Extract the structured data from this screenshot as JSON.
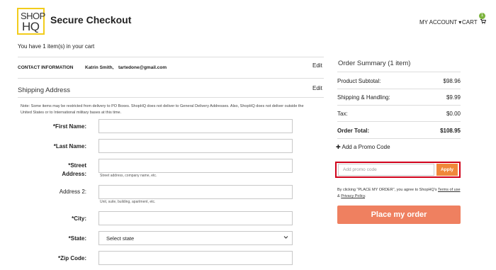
{
  "header": {
    "logo_line1": "SHOP",
    "logo_line2": "HQ",
    "title": "Secure Checkout",
    "account_label": "MY ACCOUNT ▾",
    "cart_label": "CART",
    "cart_icon": "cart-icon",
    "cart_badge": "1"
  },
  "cart_status": "You have 1 item(s) in your cart",
  "contact": {
    "label": "CONTACT INFORMATION",
    "name": "Katrin Smith,",
    "email": "tartedone@gmail.com",
    "edit_label": "Edit"
  },
  "shipping": {
    "title": "Shipping Address",
    "edit_label": "Edit",
    "note": "Note: Some items may be restricted from delivery to PO Boxes. ShopHQ does not deliver to General Delivery Addresses. Also, ShopHQ does not deliver outside the United States or to International military bases at this time.",
    "fields": {
      "first_name": "*First Name:",
      "last_name": "*Last Name:",
      "street_line1": "*Street",
      "street_line2": "Address:",
      "street_hint": "Street address, company name, etc.",
      "address2": "Address 2:",
      "address2_hint": "Unit, suite, building, apartment, etc.",
      "city": "*City:",
      "state": "*State:",
      "state_value": "Select state",
      "zip": "*Zip Code:"
    }
  },
  "summary": {
    "title": "Order Summary (1 item)",
    "rows": [
      {
        "label": "Product Subtotal:",
        "value": "$98.96"
      },
      {
        "label": "Shipping & Handling:",
        "value": "$9.99"
      },
      {
        "label": "Tax:",
        "value": "$0.00"
      }
    ],
    "total_label": "Order Total:",
    "total_value": "$108.95",
    "promo_link": "✚ Add a Promo Code",
    "promo_placeholder": "Add promo code",
    "promo_apply": "Apply",
    "legal_prefix": "By clicking \"PLACE MY ORDER\", you agree to ShopHQ's",
    "terms_link": "Terms of use",
    "legal_and": "&",
    "privacy_link": "Privacy Policy",
    "legal_suffix": ".",
    "place_order": "Place my order"
  },
  "colors": {
    "logo_border": "#f2cc1c",
    "badge": "#7bb33c",
    "apply": "#f0883a",
    "place_order": "#ef8060",
    "promo_highlight": "#d0021b"
  }
}
